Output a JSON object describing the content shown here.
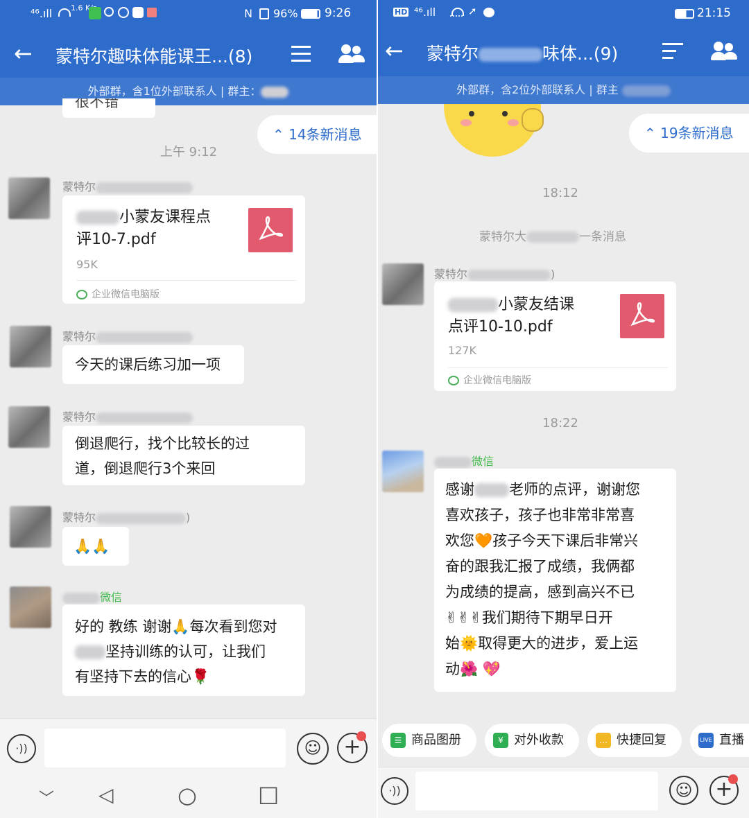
{
  "left": {
    "status_bar": {
      "signal": "⁴⁶.ıll",
      "speed": "1.6 K/s",
      "battery_text": "96%",
      "time": "9:26"
    },
    "header": {
      "title": "蒙特尔趣味体能课王...(8)"
    },
    "subheader": {
      "text": "外部群，含1位外部联系人 | 群主："
    },
    "top_fragment": "很不错",
    "new_messages": "14条新消息",
    "time_1": "上午 9:12",
    "messages": [
      {
        "sender": "蒙特尔",
        "file_name": "小蒙友课程点评10-7.pdf",
        "file_name_line1": "小蒙友课程点",
        "file_name_line2": "评10-7.pdf",
        "file_size": "95K",
        "source": "企业微信电脑版"
      },
      {
        "sender": "蒙特尔",
        "text": "今天的课后练习加一项"
      },
      {
        "sender": "蒙特尔",
        "text_line1": "倒退爬行，找个比较长的过",
        "text_line2": "道，倒退爬行3个来回"
      },
      {
        "sender": "蒙特尔",
        "sender_suffix": ")",
        "text": "🙏🙏"
      },
      {
        "sender_tag": "微信",
        "text_line1": "好的 教练 谢谢🙏每次看到您对",
        "text_line2": "坚持训练的认可，让我们",
        "text_line3": "有坚持下去的信心🌹"
      }
    ],
    "nav": {
      "down": "﹀",
      "back": "◁",
      "home": "○",
      "recent": "□"
    }
  },
  "right": {
    "status_bar": {
      "hd": "HD",
      "signal": "⁴⁶.ıll",
      "time": "21:15"
    },
    "header": {
      "title_prefix": "蒙特尔",
      "title_suffix": "味体...(9)"
    },
    "subheader": {
      "text": "外部群，含2位外部联系人 | 群主"
    },
    "new_messages": "19条新消息",
    "time_1": "18:12",
    "system_notice_prefix": "蒙特尔大",
    "system_notice_suffix": "一条消息",
    "time_2": "18:22",
    "messages": [
      {
        "sender": "蒙特尔",
        "sender_suffix": ")",
        "file_name_line1": "小蒙友结课",
        "file_name_line2": "点评10-10.pdf",
        "file_size": "127K",
        "source": "企业微信电脑版"
      },
      {
        "sender_tag": "微信",
        "lines": [
          "感谢",
          "老师的点评，谢谢您",
          "喜欢孩子，孩子也非常非常喜",
          "欢您🧡孩子今天下课后非常兴",
          "奋的跟我汇报了成绩，我俩都",
          "为成绩的提高，感到高兴不已",
          "✌✌✌我们期待下期早日开",
          "始🌞取得更大的进步，爱上运",
          "动🌺 💖"
        ]
      }
    ],
    "quick_actions": [
      {
        "label": "商品图册",
        "icon": "catalog-icon",
        "color": "#2fae53"
      },
      {
        "label": "对外收款",
        "icon": "payment-icon",
        "color": "#2fae53"
      },
      {
        "label": "快捷回复",
        "icon": "quick-reply-icon",
        "color": "#f2b824"
      },
      {
        "label": "直播",
        "icon": "live-icon",
        "color": "#2e6ccc"
      }
    ]
  },
  "colors": {
    "header_blue": "#2e6ccc",
    "pdf_red": "#e25a6e",
    "wechat_green": "#45b94e",
    "badge_red": "#e94f4f"
  }
}
